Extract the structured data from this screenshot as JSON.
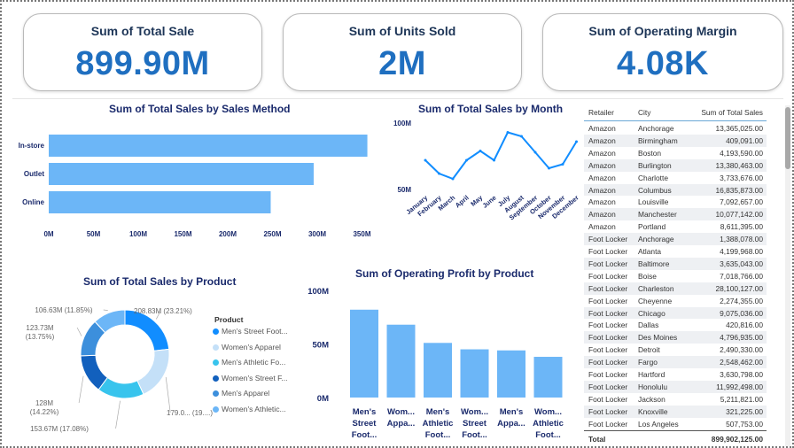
{
  "kpis": [
    {
      "title": "Sum of Total Sale",
      "value": "899.90M"
    },
    {
      "title": "Sum of Units Sold",
      "value": "2M"
    },
    {
      "title": "Sum of Operating Margin",
      "value": "4.08K"
    }
  ],
  "chart_data": [
    {
      "type": "bar",
      "orientation": "horizontal",
      "title": "Sum of Total Sales by Sales Method",
      "categories": [
        "In-store",
        "Outlet",
        "Online"
      ],
      "values": [
        356,
        296,
        248
      ],
      "value_unit": "M",
      "tick_labels": [
        "0M",
        "50M",
        "100M",
        "150M",
        "200M",
        "250M",
        "300M",
        "350M"
      ],
      "xlim": [
        0,
        350
      ],
      "color": "#6cb6f7"
    },
    {
      "type": "line",
      "title": "Sum of Total Sales by Month",
      "categories": [
        "January",
        "February",
        "March",
        "April",
        "May",
        "June",
        "July",
        "August",
        "September",
        "October",
        "November",
        "December"
      ],
      "values": [
        72,
        62,
        58,
        72,
        79,
        72,
        93,
        90,
        78,
        66,
        69,
        86
      ],
      "value_unit": "M",
      "tick_labels": [
        "100M",
        "50M"
      ],
      "ylim": [
        50,
        100
      ],
      "color": "#118dff"
    },
    {
      "type": "pie",
      "variant": "donut",
      "title": "Sum of Total Sales by Product",
      "legend_title": "Product",
      "categories": [
        "Men's Street Foot...",
        "Women's Apparel",
        "Men's Athletic Fo...",
        "Women's Street F...",
        "Men's Apparel",
        "Women's Athletic..."
      ],
      "values": [
        208.83,
        179.0,
        153.67,
        128,
        123.73,
        106.63
      ],
      "percents": [
        23.21,
        19.9,
        17.08,
        14.22,
        13.75,
        11.85
      ],
      "slice_labels": [
        [
          "208.83M (23.21%)"
        ],
        [
          "179.0... (19....)"
        ],
        [
          "153.67M (17.08%)"
        ],
        [
          "128M",
          "(14.22%)"
        ],
        [
          "123.73M",
          "(13.75%)"
        ],
        [
          "106.63M (11.85%)"
        ]
      ],
      "colors": [
        "#118dff",
        "#c4e0f8",
        "#38c4ed",
        "#1260bd",
        "#3c8fdc",
        "#6cb6f7"
      ]
    },
    {
      "type": "bar",
      "title": "Sum of Operating Profit by Product",
      "categories": [
        [
          "Men's",
          "Street",
          "Foot..."
        ],
        [
          "Wom...",
          "Appa..."
        ],
        [
          "Men's",
          "Athletic",
          "Foot..."
        ],
        [
          "Wom...",
          "Street",
          "Foot..."
        ],
        [
          "Men's",
          "Appa..."
        ],
        [
          "Wom...",
          "Athletic",
          "Foot..."
        ]
      ],
      "values": [
        82,
        68,
        51,
        45,
        44,
        38
      ],
      "value_unit": "M",
      "tick_labels": [
        "100M",
        "50M",
        "0M"
      ],
      "ylim": [
        0,
        100
      ],
      "color": "#6cb6f7"
    }
  ],
  "table": {
    "columns": [
      "Retailer",
      "City",
      "Sum of Total Sales"
    ],
    "rows": [
      [
        "Amazon",
        "Anchorage",
        "13,365,025.00"
      ],
      [
        "Amazon",
        "Birmingham",
        "409,091.00"
      ],
      [
        "Amazon",
        "Boston",
        "4,193,590.00"
      ],
      [
        "Amazon",
        "Burlington",
        "13,380,463.00"
      ],
      [
        "Amazon",
        "Charlotte",
        "3,733,676.00"
      ],
      [
        "Amazon",
        "Columbus",
        "16,835,873.00"
      ],
      [
        "Amazon",
        "Louisville",
        "7,092,657.00"
      ],
      [
        "Amazon",
        "Manchester",
        "10,077,142.00"
      ],
      [
        "Amazon",
        "Portland",
        "8,611,395.00"
      ],
      [
        "Foot Locker",
        "Anchorage",
        "1,388,078.00"
      ],
      [
        "Foot Locker",
        "Atlanta",
        "4,199,968.00"
      ],
      [
        "Foot Locker",
        "Baltimore",
        "3,635,043.00"
      ],
      [
        "Foot Locker",
        "Boise",
        "7,018,766.00"
      ],
      [
        "Foot Locker",
        "Charleston",
        "28,100,127.00"
      ],
      [
        "Foot Locker",
        "Cheyenne",
        "2,274,355.00"
      ],
      [
        "Foot Locker",
        "Chicago",
        "9,075,036.00"
      ],
      [
        "Foot Locker",
        "Dallas",
        "420,816.00"
      ],
      [
        "Foot Locker",
        "Des Moines",
        "4,796,935.00"
      ],
      [
        "Foot Locker",
        "Detroit",
        "2,490,330.00"
      ],
      [
        "Foot Locker",
        "Fargo",
        "2,548,462.00"
      ],
      [
        "Foot Locker",
        "Hartford",
        "3,630,798.00"
      ],
      [
        "Foot Locker",
        "Honolulu",
        "11,992,498.00"
      ],
      [
        "Foot Locker",
        "Jackson",
        "5,211,821.00"
      ],
      [
        "Foot Locker",
        "Knoxville",
        "321,225.00"
      ],
      [
        "Foot Locker",
        "Los Angeles",
        "507,753.00"
      ]
    ],
    "total_label": "Total",
    "total_value": "899,902,125.00"
  }
}
